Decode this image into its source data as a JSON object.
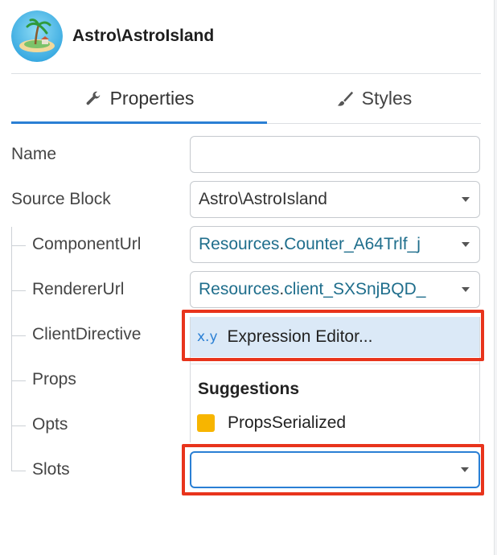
{
  "header": {
    "title": "Astro\\AstroIsland"
  },
  "tabs": [
    {
      "label": "Properties",
      "icon": "wrench-icon",
      "active": true
    },
    {
      "label": "Styles",
      "icon": "brush-icon",
      "active": false
    }
  ],
  "form": {
    "name": {
      "label": "Name",
      "value": ""
    },
    "source_block": {
      "label": "Source Block",
      "value": "Astro\\AstroIsland"
    },
    "component_url": {
      "label": "ComponentUrl",
      "value_prefix": "Resources",
      "value_suffix": "Counter_A64Trlf_j",
      "dot": "."
    },
    "renderer_url": {
      "label": "RendererUrl",
      "value_prefix": "Resources",
      "value_suffix": "client_SXSnjBQD_",
      "dot": "."
    },
    "client_directive": {
      "label": "ClientDirective"
    },
    "props": {
      "label": "Props"
    },
    "opts": {
      "label": "Opts"
    },
    "slots": {
      "label": "Slots",
      "value": ""
    }
  },
  "dropdown": {
    "expression_icon_text": "x.y",
    "expression_label": "Expression Editor...",
    "suggestions_heading": "Suggestions",
    "suggestions": [
      {
        "label": "PropsSerialized",
        "color": "#f7b500"
      }
    ]
  },
  "colors": {
    "accent": "#2a7fd4",
    "highlight": "#e8341c",
    "resource_text": "#1f6e8c"
  }
}
